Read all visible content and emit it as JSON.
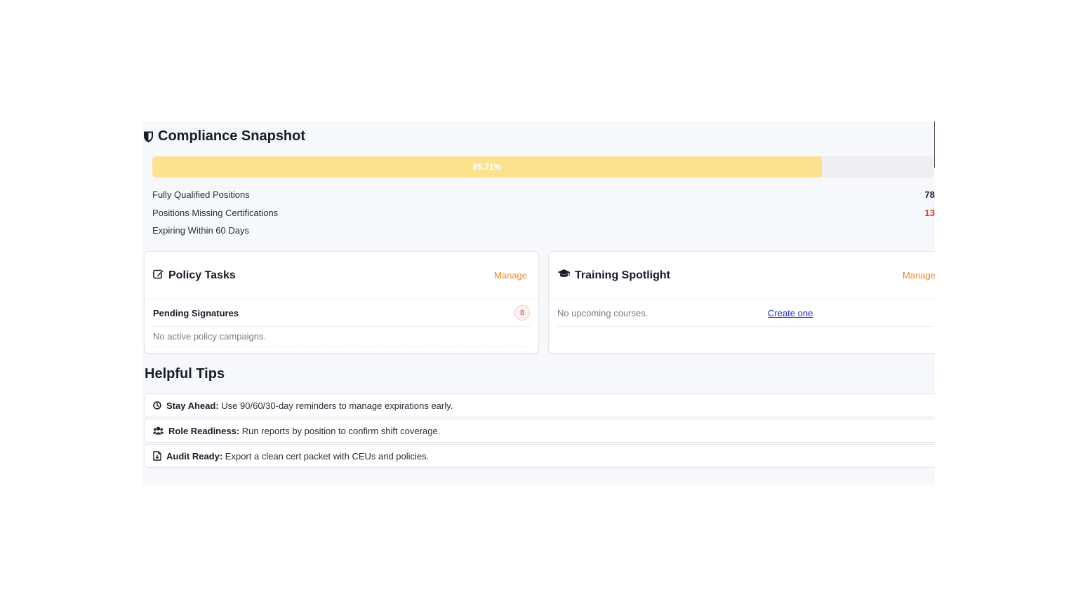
{
  "snapshot": {
    "title": "Compliance Snapshot",
    "progress_label": "85.71%",
    "progress_fraction": 0.8571,
    "stats": [
      {
        "label": "Fully Qualified Positions",
        "value": "78"
      },
      {
        "label": "Positions Missing Certifications",
        "value": "13"
      },
      {
        "label": "Expiring Within 60 Days",
        "value": ""
      }
    ]
  },
  "policy": {
    "title": "Policy Tasks",
    "manage": "Manage",
    "pending_label": "Pending Signatures",
    "pending_count": "8",
    "empty": "No active policy campaigns."
  },
  "training": {
    "title": "Training Spotlight",
    "manage": "Manage",
    "empty": "No upcoming courses.",
    "create": "Create one"
  },
  "tips": {
    "title": "Helpful Tips",
    "items": [
      {
        "icon": "clock-icon",
        "label": "Stay Ahead:",
        "text": "Use 90/60/30-day reminders to manage expirations early."
      },
      {
        "icon": "users-icon",
        "label": "Role Readiness:",
        "text": "Run reports by position to confirm shift coverage."
      },
      {
        "icon": "file-export-icon",
        "label": "Audit Ready:",
        "text": "Export a clean cert packet with CEUs and policies."
      }
    ]
  },
  "colors": {
    "progress_fill": "#fce28f",
    "accent": "#f08a24",
    "danger": "#e0392b",
    "link": "#1a2ad8"
  }
}
